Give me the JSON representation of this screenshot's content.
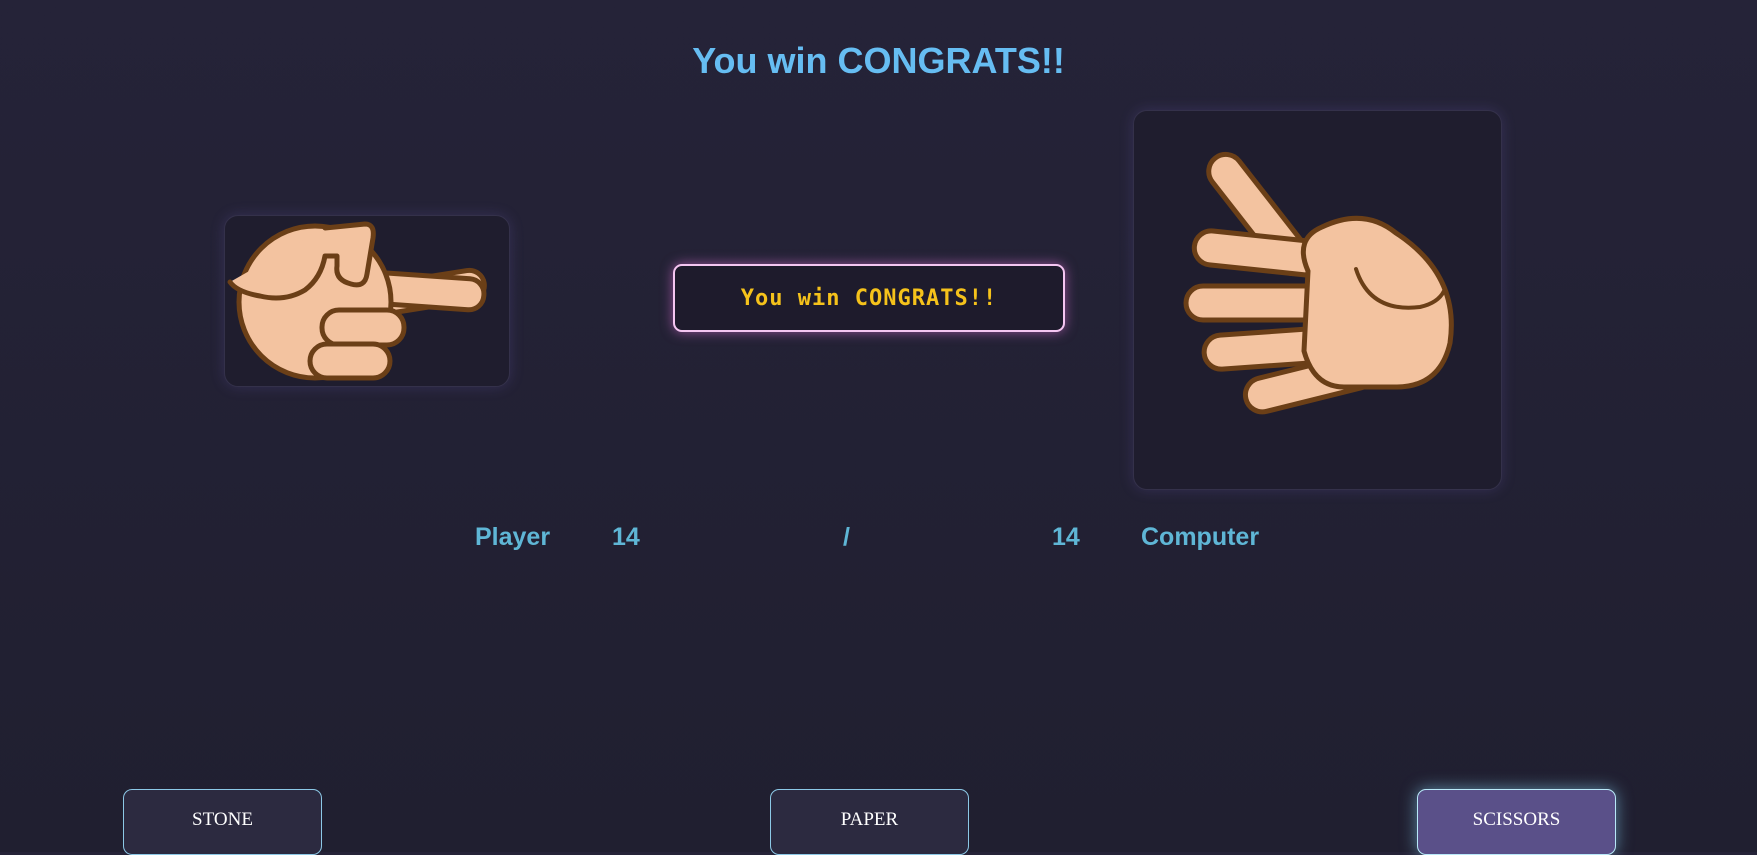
{
  "header": {
    "title": "You win CONGRATS!!",
    "color": "#66bdf2"
  },
  "player": {
    "choice": "scissors",
    "icon": "scissors-hand-icon"
  },
  "computer": {
    "choice": "paper",
    "icon": "paper-hand-icon"
  },
  "result": {
    "message": "You win CONGRATS!!",
    "text_color": "#f5c21b",
    "border_color": "#f5c6f2"
  },
  "score": {
    "player_label": "Player",
    "player_score": "14",
    "separator": "/",
    "computer_score": "14",
    "computer_label": "Computer",
    "color": "#5fb6d6"
  },
  "controls": {
    "stone_label": "STONE",
    "paper_label": "PAPER",
    "scissors_label": "SCISSORS",
    "selected": "SCISSORS",
    "accent": "#8cc8e6"
  }
}
